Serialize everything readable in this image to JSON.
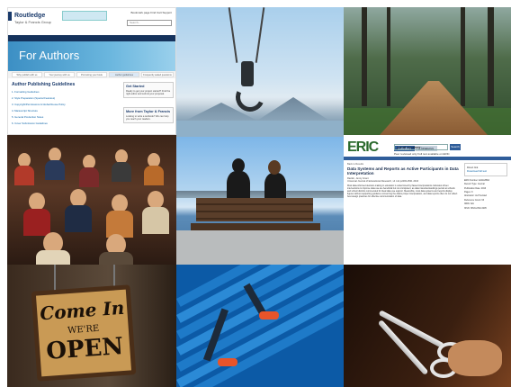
{
  "routledge": {
    "logo_name": "Routledge",
    "logo_tagline": "Taylor & Francis Group",
    "top_links": "Bookmark page   Find Cart   Support",
    "search_placeholder": "Search...",
    "nav": [
      "Subjects",
      "Textbooks",
      "Resources",
      "Offer Help",
      "Featured Authors"
    ],
    "hero_title": "For Authors",
    "tabs": [
      "Why publish with us",
      "Your journey with us",
      "Promoting your book",
      "Author guidelines",
      "Frequently asked questions"
    ],
    "heading": "Author Publishing Guidelines",
    "guidelines": [
      "1. Formatting Guidelines",
      "2. Style Preparation (Special Features)",
      "3. Copyright/Permissions & Global Reuse Policy",
      "4. Manuscript Structure",
      "5. General Production Notes",
      "6. Cover Submission Guidelines"
    ],
    "box1_title": "Get Started",
    "box1_text": "Ready to get your project started? Find the right editor and submit your proposal.",
    "box2_title": "More from Taylor & Francis",
    "box2_text": "Looking to write a textbook? We can help you reach your readers."
  },
  "eric": {
    "logo": "ERIC",
    "tabs": [
      "Collection",
      "Thesaurus"
    ],
    "search_value": "journal repository",
    "search_button": "Search",
    "options": "Peer reviewed only    Full text available on ERIC",
    "breadcrumb": "Back to Results",
    "title": "Data Systems and Reports as Active Participants in Data Interpretation",
    "author": "Rankin, Jenny Grant",
    "source": "Universal Journal of Educational Research, v4 n11 p2493-2501 2016",
    "abstract": "Most data-informed decision-making in education is undermined by flawed interpretations. Educator-driven interventions to improve data use are beneficial but not omnipotent, as data misunderstandings persist at schools and school districts commended for ideal data use support. Meanwhile, most data systems and reports display figures without supporting guidance concerning the data's proper interpretation, and data reports often do not reflect best design practices for effective communication of data.",
    "sidebar": [
      "Direct link",
      "Download full text",
      "ERIC Number: EJ1118864",
      "Record Type: Journal",
      "Publication Date: 2016",
      "Pages: 9",
      "Abstractor: As Provided",
      "Reference Count: 63",
      "ISBN: N/A",
      "ISSN: ISSN-2332-3205"
    ]
  },
  "sign": {
    "line1": "Come In",
    "line2": "WE'RE",
    "line3": "OPEN"
  }
}
